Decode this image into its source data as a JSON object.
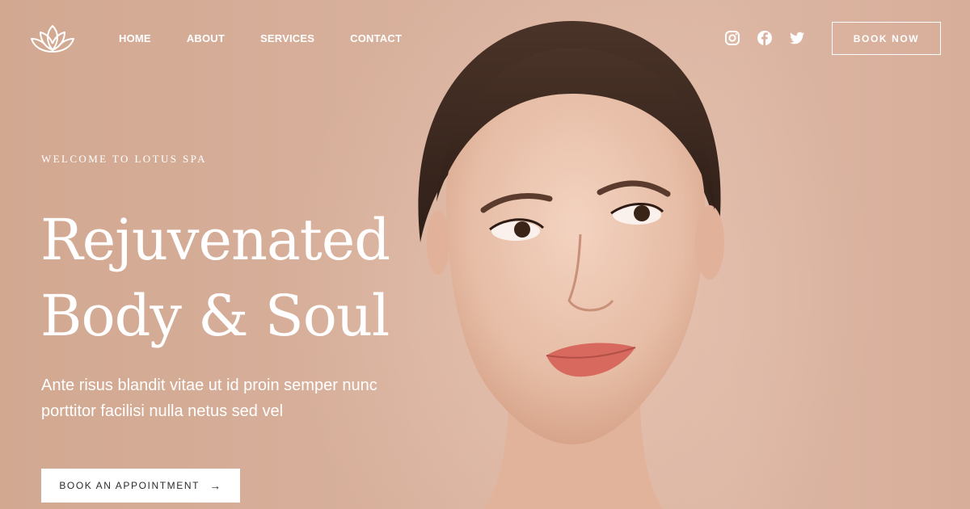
{
  "header": {
    "nav": [
      "HOME",
      "ABOUT",
      "SERVICES",
      "CONTACT"
    ],
    "socials": [
      "instagram-icon",
      "facebook-icon",
      "twitter-icon"
    ],
    "book_now_label": "BOOK NOW"
  },
  "hero": {
    "eyebrow": "WELCOME TO LOTUS SPA",
    "headline_line1": "Rejuvenated",
    "headline_line2": "Body & Soul",
    "subtitle_line1": "Ante risus blandit vitae ut id proin semper nunc",
    "subtitle_line2": "porttitor facilisi nulla netus sed vel",
    "cta_label": "BOOK AN APPOINTMENT",
    "cta_arrow": "→"
  },
  "colors": {
    "background": "#d9b29f",
    "text": "#ffffff",
    "cta_bg": "#ffffff",
    "cta_text": "#2b2b2b"
  }
}
